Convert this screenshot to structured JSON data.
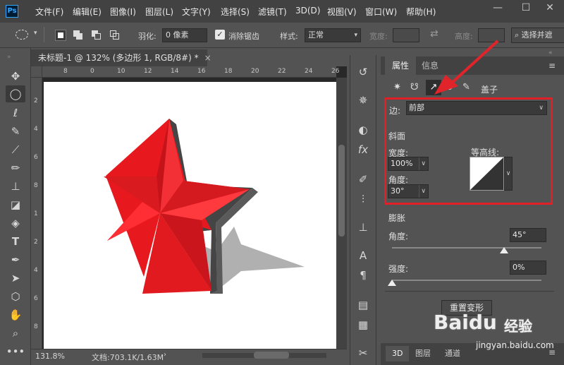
{
  "app": {
    "logo": "Ps"
  },
  "menu": [
    "文件(F)",
    "编辑(E)",
    "图像(I)",
    "图层(L)",
    "文字(Y)",
    "选择(S)",
    "滤镜(T)",
    "3D(D)",
    "视图(V)",
    "窗口(W)",
    "帮助(H)"
  ],
  "window_controls": {
    "minimize": "—",
    "maximize": "☐",
    "close": "✕"
  },
  "options": {
    "feather_label": "羽化:",
    "feather_value": "0 像素",
    "antialias_label": "消除锯齿",
    "style_label": "样式:",
    "style_value": "正常",
    "width_label": "宽度:",
    "height_label": "高度:",
    "select_mask_label": "选择并遮"
  },
  "document": {
    "tab_title": "未标题-1 @ 132% (多边形 1, RGB/8#) *",
    "close": "×",
    "ruler_ticks_h": [
      "8",
      "0",
      "10",
      "12",
      "14",
      "16",
      "18",
      "20",
      "22",
      "24",
      "26"
    ],
    "ruler_ticks_v": [
      "2",
      "4",
      "6",
      "8",
      "1",
      "2",
      "4",
      "6",
      "8"
    ],
    "zoom": "131.8%",
    "doc_size": "文档:703.1K/1.63M"
  },
  "properties": {
    "tabs": [
      "属性",
      "信息"
    ],
    "active_tab": "属性",
    "subtab_cap": "盖子",
    "side_label": "边:",
    "side_value": "前部",
    "bevel_section": "斜面",
    "width_label": "宽度:",
    "width_value": "100%",
    "contour_label": "等高线:",
    "angle_label": "角度:",
    "angle_value": "30°",
    "inflate_section": "膨胀",
    "inflate_angle_label": "角度:",
    "inflate_angle_value": "45°",
    "inflate_angle_level": 0.75,
    "strength_label": "强度:",
    "strength_value": "0%",
    "strength_level": 0,
    "reset_button": "重置变形"
  },
  "bottom_tabs": [
    "3D",
    "图层",
    "通道"
  ],
  "watermark": {
    "brand": "Baidu",
    "cn": "经验",
    "url": "jingyan.baidu.com"
  },
  "colors": {
    "highlight_box": "#e21f26",
    "star_red": "#e8191e",
    "arrow": "#e0242a"
  }
}
